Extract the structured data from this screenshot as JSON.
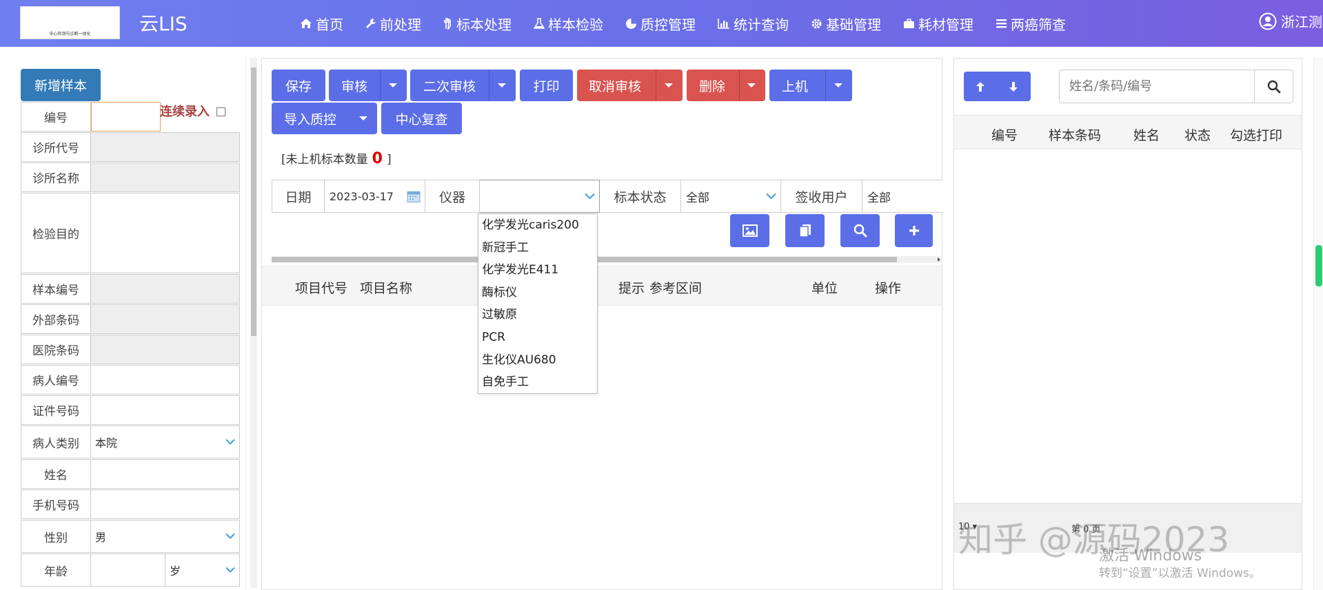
{
  "header": {
    "logo_text": "中心检测与诊断一体化",
    "app_title": "云LIS",
    "nav": [
      {
        "label": "首页",
        "icon": "home-icon"
      },
      {
        "label": "前处理",
        "icon": "wrench-icon"
      },
      {
        "label": "标本处理",
        "icon": "hand-icon"
      },
      {
        "label": "样本检验",
        "icon": "flask-icon"
      },
      {
        "label": "质控管理",
        "icon": "pie-chart-icon"
      },
      {
        "label": "统计查询",
        "icon": "bar-chart-icon"
      },
      {
        "label": "基础管理",
        "icon": "gear-icon"
      },
      {
        "label": "耗材管理",
        "icon": "briefcase-icon"
      },
      {
        "label": "两癌筛查",
        "icon": "list-icon"
      }
    ],
    "user": "浙江测"
  },
  "left": {
    "new_sample": "新增样本",
    "continuous": "连续录入",
    "fields": [
      {
        "label": "编号",
        "value": ""
      },
      {
        "label": "诊所代号",
        "value": ""
      },
      {
        "label": "诊所名称",
        "value": ""
      },
      {
        "label": "检验目的",
        "value": ""
      },
      {
        "label": "样本编号",
        "value": ""
      },
      {
        "label": "外部条码",
        "value": ""
      },
      {
        "label": "医院条码",
        "value": ""
      },
      {
        "label": "病人编号",
        "value": ""
      },
      {
        "label": "证件号码",
        "value": ""
      },
      {
        "label": "病人类别",
        "value": "本院"
      },
      {
        "label": "姓名",
        "value": ""
      },
      {
        "label": "手机号码",
        "value": ""
      },
      {
        "label": "性别",
        "value": "男"
      },
      {
        "label": "年龄",
        "value": "",
        "unit": "岁"
      }
    ]
  },
  "toolbar": {
    "save": "保存",
    "audit": "审核",
    "second_audit": "二次审核",
    "print": "打印",
    "cancel_audit": "取消审核",
    "delete": "删除",
    "upload": "上机",
    "import_qc": "导入质控",
    "center_review": "中心复查"
  },
  "unsent": {
    "prefix": "[未上机标本数量",
    "count": "0",
    "suffix": "]"
  },
  "filters": {
    "date_label": "日期",
    "date_value": "2023-03-17",
    "instrument_label": "仪器",
    "instrument_value": "",
    "status_label": "标本状态",
    "status_value": "全部",
    "user_label": "签收用户",
    "user_value": "全部"
  },
  "instrument_options": [
    "化学发光caris200",
    "新冠手工",
    "化学发光E411",
    "酶标仪",
    "过敏原",
    "PCR",
    "生化仪AU680",
    "自免手工"
  ],
  "mid_table": {
    "headers": [
      "项目代号",
      "项目名称",
      "提示",
      "参考区间",
      "单位",
      "操作"
    ]
  },
  "right": {
    "search_placeholder": "姓名/条码/编号",
    "headers": [
      "编号",
      "样本条码",
      "姓名",
      "状态",
      "勾选打印"
    ],
    "footer_left": "10 ▾",
    "footer_mid": "第 0 页"
  },
  "watermark": {
    "text": "知乎 @源码2023",
    "activate1": "激活 Windows",
    "activate2": "转到“设置”以激活 Windows。"
  }
}
